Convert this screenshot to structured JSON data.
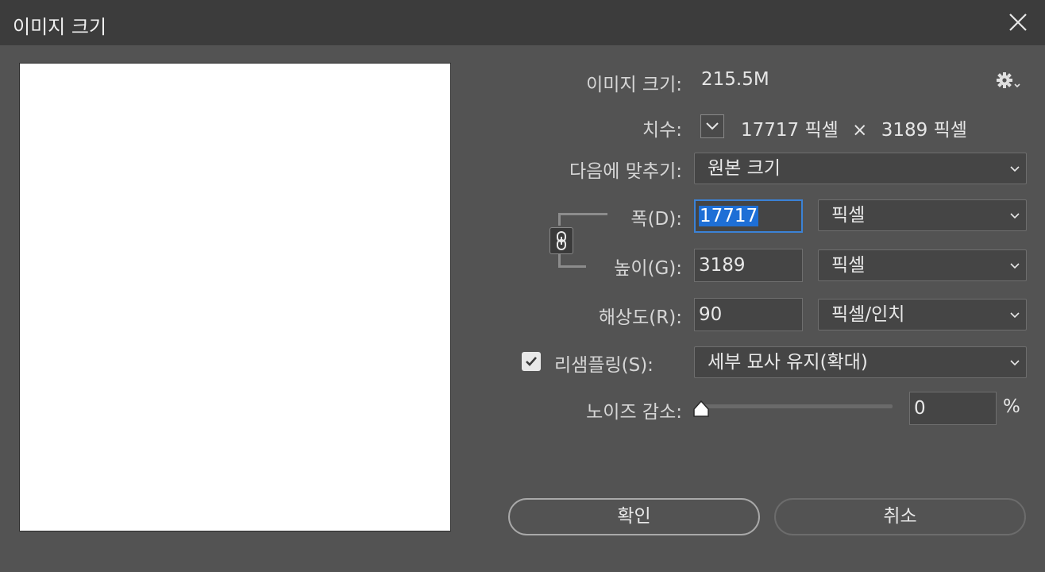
{
  "window": {
    "title": "이미지 크기"
  },
  "image_size": {
    "label": "이미지 크기:",
    "value": "215.5M"
  },
  "dimensions": {
    "label": "치수:",
    "width_value": "17717",
    "width_unit": "픽셀",
    "separator": "×",
    "height_value": "3189",
    "height_unit": "픽셀"
  },
  "fit_to": {
    "label": "다음에 맞추기:",
    "selected": "원본 크기"
  },
  "width": {
    "label": "폭(D):",
    "value": "17717",
    "unit": "픽셀"
  },
  "height": {
    "label": "높이(G):",
    "value": "3189",
    "unit": "픽셀"
  },
  "resolution": {
    "label": "해상도(R):",
    "value": "90",
    "unit": "픽셀/인치"
  },
  "resample": {
    "label": "리샘플링(S):",
    "checked": true,
    "method": "세부 묘사 유지(확대)"
  },
  "noise_reduction": {
    "label": "노이즈 감소:",
    "value": "0",
    "unit": "%",
    "slider_percent": 0
  },
  "buttons": {
    "ok": "확인",
    "cancel": "취소"
  },
  "colors": {
    "background": "#535353",
    "titlebar": "#3c3c3c",
    "focus": "#3b82d6",
    "selection": "#1e6fd6"
  }
}
